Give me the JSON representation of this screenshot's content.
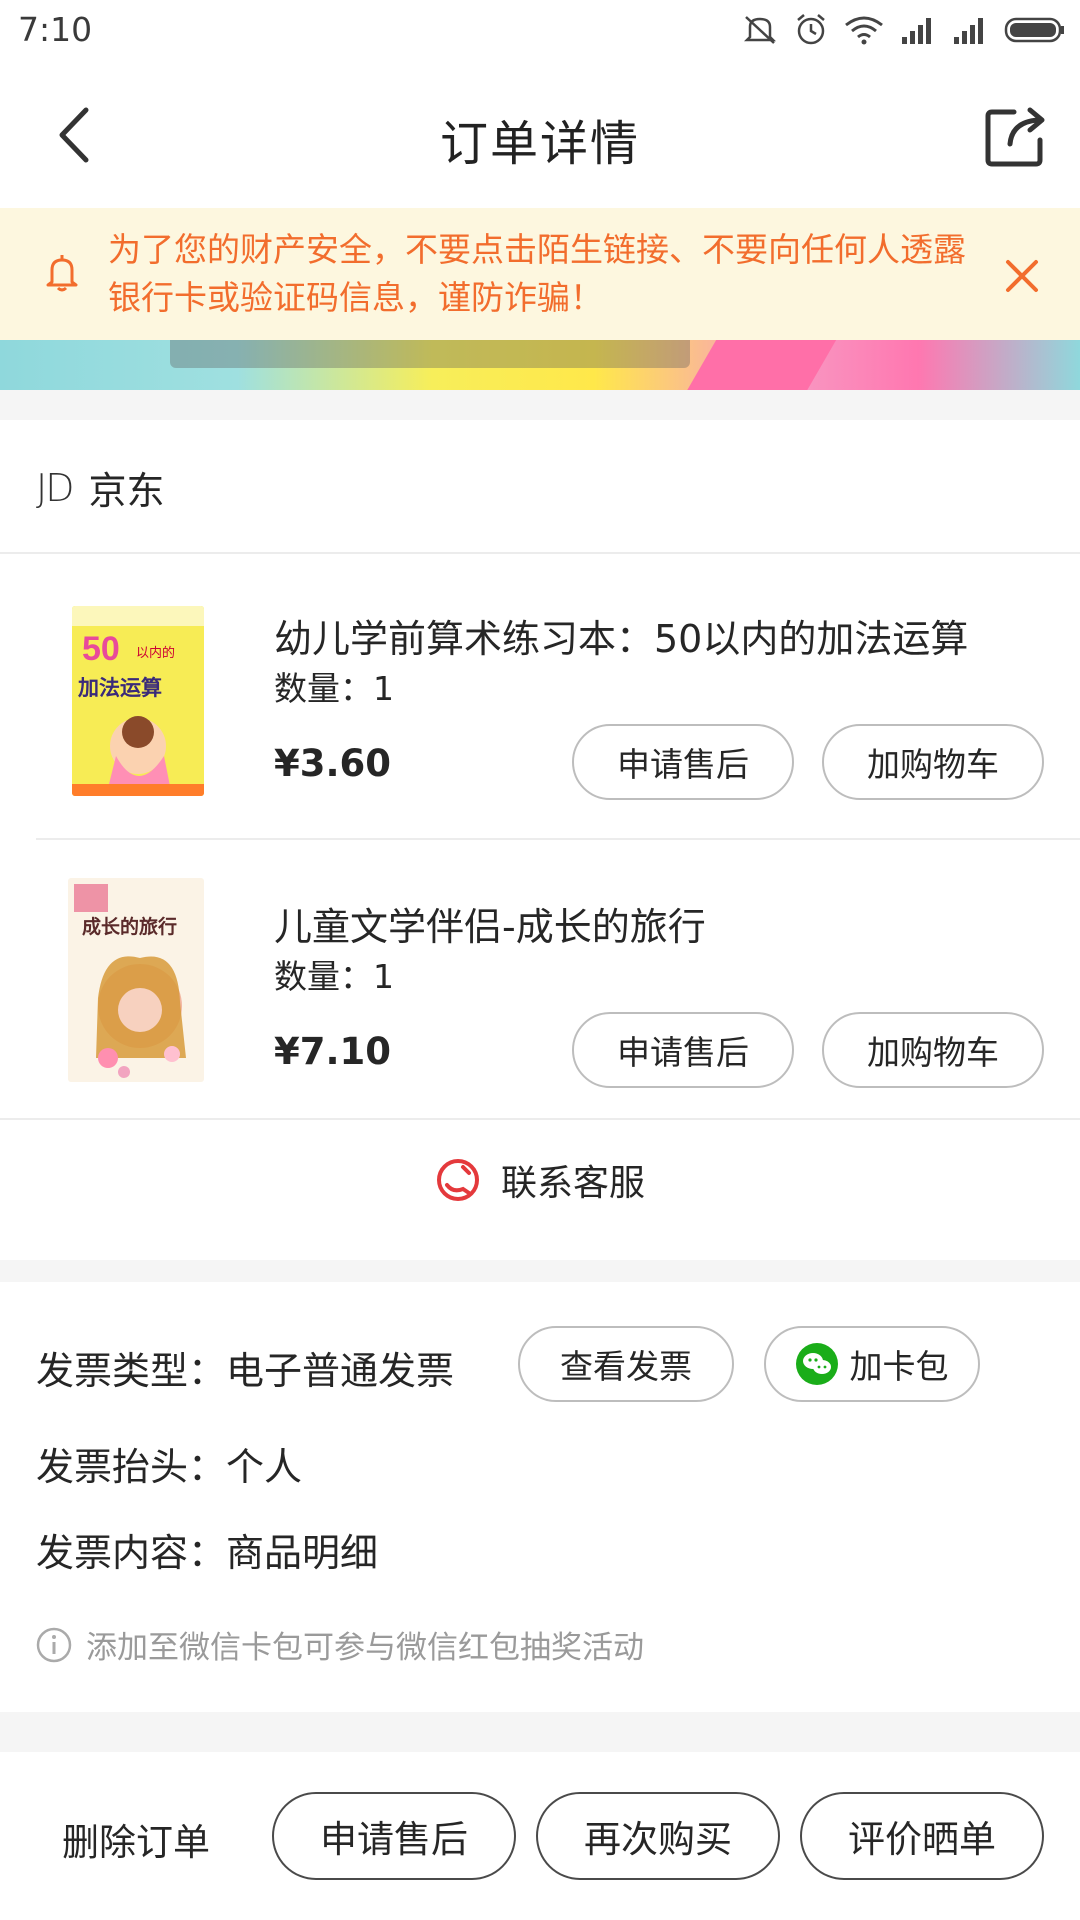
{
  "status_bar": {
    "time": "7:10",
    "icons": [
      "mute-icon",
      "alarm-icon",
      "wifi-icon",
      "signal-icon",
      "signal-icon",
      "battery-icon"
    ]
  },
  "nav": {
    "title": "订单详情",
    "back_icon": "back-arrow-icon",
    "share_icon": "share-icon"
  },
  "notice": {
    "text": "为了您的财产安全，不要点击陌生链接、不要向任何人透露银行卡或验证码信息，谨防诈骗！",
    "color": "#f26d2d"
  },
  "shop": {
    "logo": "JD",
    "name": "京东",
    "products": [
      {
        "title": "幼儿学前算术练习本：50以内的加法运算",
        "qty": "数量：1",
        "price": "¥3.60",
        "btn_after_sale": "申请售后",
        "btn_add_cart": "加购物车",
        "cover_text_big": "50",
        "cover_text_small": "以内的",
        "cover_text_main": "加法运算"
      },
      {
        "title": "儿童文学伴侣-成长的旅行",
        "qty": "数量：1",
        "price": "¥7.10",
        "btn_after_sale": "申请售后",
        "btn_add_cart": "加购物车",
        "cover_text_main": "成长的旅行"
      }
    ],
    "customer_service": "联系客服"
  },
  "invoice": {
    "type": "发票类型：电子普通发票",
    "view_btn": "查看发票",
    "card_btn": "加卡包",
    "title": "发票抬头：个人",
    "content": "发票内容：商品明细",
    "note": "添加至微信卡包可参与微信红包抽奖活动"
  },
  "bottom": {
    "delete": "删除订单",
    "after_sale": "申请售后",
    "buy_again": "再次购买",
    "review": "评价晒单"
  },
  "colors": {
    "accent": "#e4393c",
    "wechat": "#1aad19"
  }
}
